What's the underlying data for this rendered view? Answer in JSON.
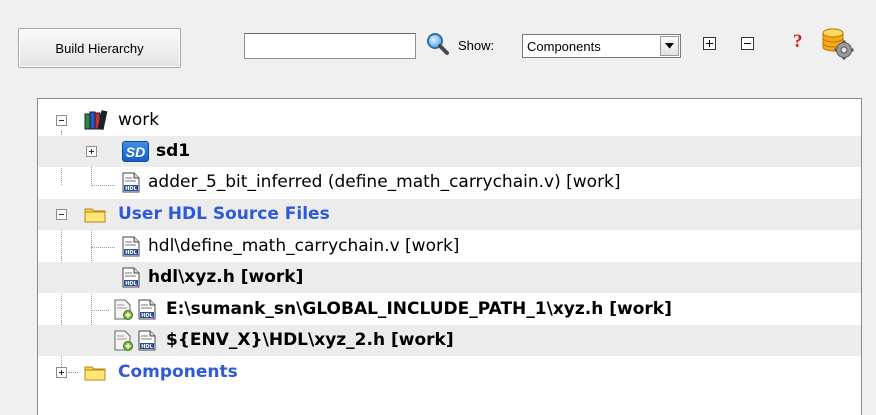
{
  "toolbar": {
    "build_hierarchy_label": "Build Hierarchy",
    "search_value": "",
    "show_label": "Show:",
    "show_selected": "Components"
  },
  "tree": {
    "work": {
      "label": "work"
    },
    "sd1": {
      "label": "sd1",
      "badge": "SD"
    },
    "adder": {
      "label": "adder_5_bit_inferred (define_math_carrychain.v) [work]"
    },
    "user_hdl": {
      "label": "User HDL Source Files"
    },
    "file1": {
      "label": "hdl\\define_math_carrychain.v [work]"
    },
    "file2": {
      "label": "hdl\\xyz.h [work]"
    },
    "file3": {
      "label": "E:\\sumank_sn\\GLOBAL_INCLUDE_PATH_1\\xyz.h [work]"
    },
    "file4": {
      "label": "${ENV_X}\\HDL\\xyz_2.h [work]"
    },
    "components": {
      "label": "Components"
    }
  },
  "colors": {
    "folder_label_blue": "#2f59d6",
    "row_shade": "#ececec",
    "help_red": "#e01818"
  },
  "icons": [
    "search-icon",
    "expand-all-icon",
    "collapse-all-icon",
    "help-icon",
    "database-settings-icon",
    "library-books-icon",
    "sd-icon",
    "hdl-file-icon",
    "folder-icon",
    "linked-file-icon"
  ]
}
